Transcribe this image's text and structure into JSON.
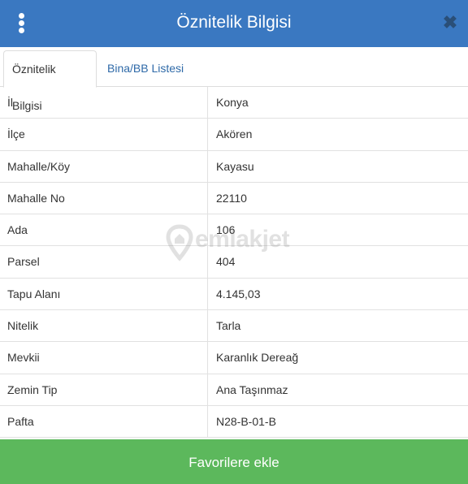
{
  "header": {
    "title": "Öznitelik Bilgisi",
    "close_symbol": "✖",
    "menu_icon": "vertical-ellipsis-icon",
    "close_icon": "close-icon"
  },
  "tabs": [
    {
      "label": "Öznitelik Bilgisi",
      "active": true
    },
    {
      "label": "Bina/BB Listesi",
      "active": false
    }
  ],
  "attributes": [
    {
      "key": "İl",
      "value": "Konya"
    },
    {
      "key": "İlçe",
      "value": "Akören"
    },
    {
      "key": "Mahalle/Köy",
      "value": "Kayasu"
    },
    {
      "key": "Mahalle No",
      "value": "22110"
    },
    {
      "key": "Ada",
      "value": "106"
    },
    {
      "key": "Parsel",
      "value": "404"
    },
    {
      "key": "Tapu Alanı",
      "value": "4.145,03"
    },
    {
      "key": "Nitelik",
      "value": "Tarla"
    },
    {
      "key": "Mevkii",
      "value": "Karanlık Dereağ"
    },
    {
      "key": "Zemin Tip",
      "value": "Ana Taşınmaz"
    },
    {
      "key": "Pafta",
      "value": "N28-B-01-B"
    }
  ],
  "watermark": {
    "text": "emlakjet",
    "icon": "location-pin-icon"
  },
  "footer": {
    "button_label": "Favorilere ekle"
  },
  "colors": {
    "header": "#3a78c1",
    "tab_link": "#2f6aa8",
    "button": "#5cb85c",
    "close": "#2a4f78"
  }
}
